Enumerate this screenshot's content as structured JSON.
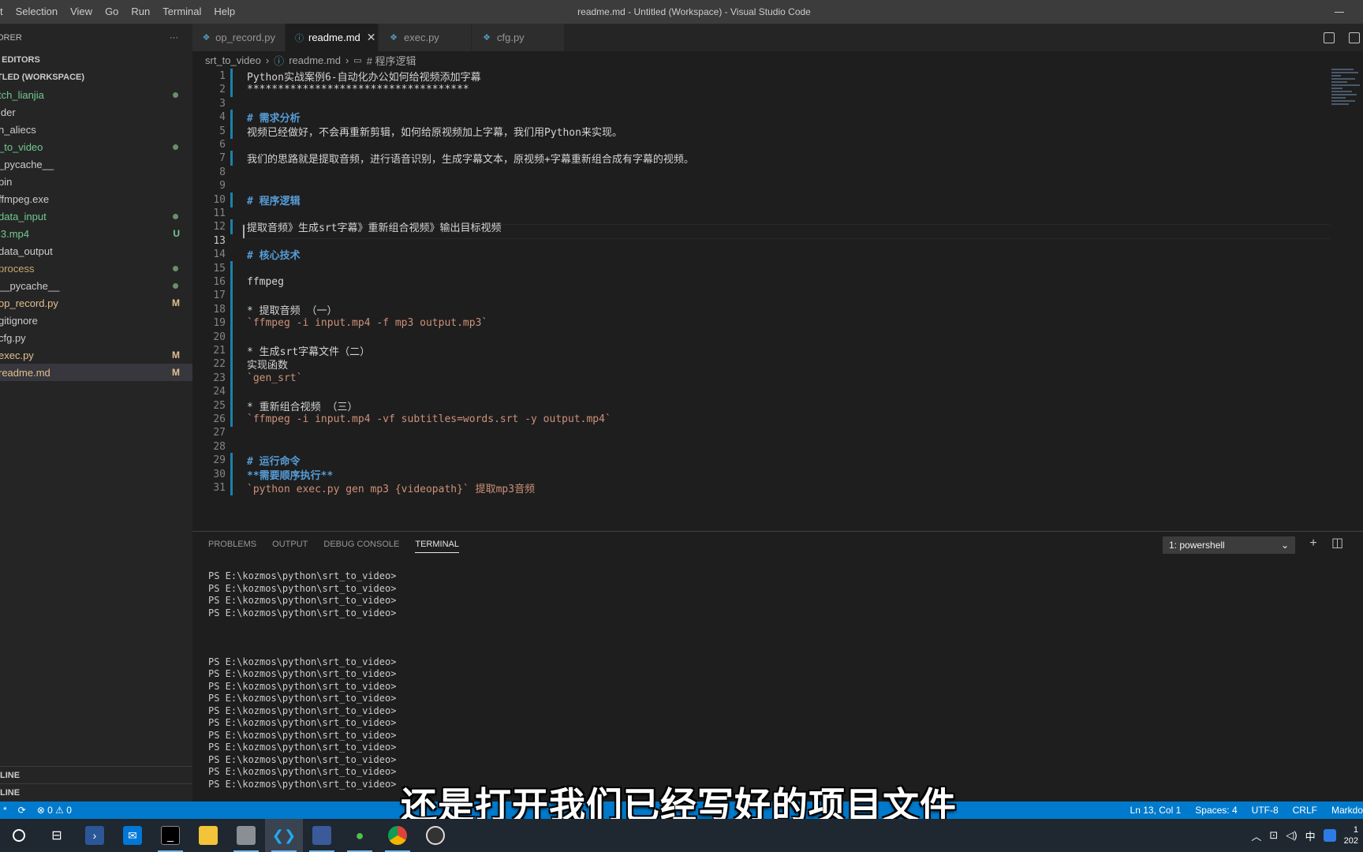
{
  "menu": [
    "t",
    "Selection",
    "View",
    "Go",
    "Run",
    "Terminal",
    "Help"
  ],
  "window_title": "readme.md - Untitled (Workspace) - Visual Studio Code",
  "sidebar": {
    "header": "ORER",
    "header_more": "···",
    "open_editors": "I EDITORS",
    "workspace": "TLED (WORKSPACE)",
    "items": [
      {
        "label": "tch_lianjia",
        "status": "dot",
        "color": "green"
      },
      {
        "label": "ider",
        "status": "",
        "color": ""
      },
      {
        "label": "n_aliecs",
        "status": "",
        "color": ""
      },
      {
        "label": "_to_video",
        "status": "dot",
        "color": "green"
      },
      {
        "label": "_pycache__",
        "status": "",
        "color": ""
      },
      {
        "label": "bin",
        "status": "",
        "color": ""
      },
      {
        "label": " ffmpeg.exe",
        "status": "",
        "color": ""
      },
      {
        "label": "data_input",
        "status": "dot",
        "color": "green"
      },
      {
        "label": " i3.mp4",
        "status": "U",
        "color": "green"
      },
      {
        "label": "data_output",
        "status": "",
        "color": ""
      },
      {
        "label": "process",
        "status": "dot",
        "color": "brown"
      },
      {
        "label": " __pycache__",
        "status": "dot",
        "color": ""
      },
      {
        "label": " op_record.py",
        "status": "M",
        "color": "yellow"
      },
      {
        "label": "gitignore",
        "status": "",
        "color": ""
      },
      {
        "label": "cfg.py",
        "status": "",
        "color": ""
      },
      {
        "label": "exec.py",
        "status": "M",
        "color": "yellow"
      },
      {
        "label": "readme.md",
        "status": "M",
        "color": "yellow",
        "active": true
      }
    ],
    "outline": "LINE",
    "timeline": "LINE"
  },
  "tabs": [
    {
      "label": "op_record.py",
      "icon": "python-icon",
      "active": false
    },
    {
      "label": "readme.md",
      "icon": "info-icon",
      "active": true,
      "close": "✕"
    },
    {
      "label": "exec.py",
      "icon": "python-icon",
      "active": false
    },
    {
      "label": "cfg.py",
      "icon": "python-icon",
      "active": false
    }
  ],
  "breadcrumb": {
    "folder": "srt_to_video",
    "file": "readme.md",
    "symbol": "# 程序逻辑"
  },
  "editor": {
    "lines": [
      {
        "n": "1",
        "text": "Python实战案例6-自动化办公如何给视频添加字幕",
        "style": "",
        "mod": true
      },
      {
        "n": "2",
        "text": "************************************",
        "style": "",
        "mod": true
      },
      {
        "n": "3",
        "text": "",
        "style": "",
        "mod": false
      },
      {
        "n": "4",
        "text": "# 需求分析",
        "style": "heading",
        "mod": true
      },
      {
        "n": "5",
        "text": "视频已经做好，不会再重新剪辑，如何给原视频加上字幕，我们用Python来实现。",
        "style": "",
        "mod": true
      },
      {
        "n": "6",
        "text": "",
        "style": "",
        "mod": false
      },
      {
        "n": "7",
        "text": "我们的思路就是提取音频，进行语音识别，生成字幕文本，原视频+字幕重新组合成有字幕的视频。",
        "style": "",
        "mod": true
      },
      {
        "n": "8",
        "text": "",
        "style": "",
        "mod": false
      },
      {
        "n": "9",
        "text": "",
        "style": "",
        "mod": false
      },
      {
        "n": "10",
        "text": "# 程序逻辑",
        "style": "heading",
        "mod": true
      },
      {
        "n": "11",
        "text": "",
        "style": "",
        "mod": false
      },
      {
        "n": "12",
        "text": "提取音频》生成srt字幕》重新组合视频》输出目标视频",
        "style": "",
        "mod": true
      },
      {
        "n": "13",
        "text": "",
        "style": "",
        "mod": false
      },
      {
        "n": "14",
        "text": "# 核心技术",
        "style": "heading",
        "mod": false
      },
      {
        "n": "15",
        "text": "",
        "style": "",
        "mod": true
      },
      {
        "n": "16",
        "text": "ffmpeg",
        "style": "",
        "mod": true
      },
      {
        "n": "17",
        "text": "",
        "style": "",
        "mod": true
      },
      {
        "n": "18",
        "text": "* 提取音频 （一）",
        "style": "",
        "mod": true
      },
      {
        "n": "19",
        "text": "`ffmpeg -i input.mp4 -f mp3 output.mp3`",
        "style": "inline",
        "mod": true
      },
      {
        "n": "20",
        "text": "",
        "style": "",
        "mod": true
      },
      {
        "n": "21",
        "text": "* 生成srt字幕文件（二）",
        "style": "",
        "mod": true
      },
      {
        "n": "22",
        "text": "实现函数",
        "style": "",
        "mod": true
      },
      {
        "n": "23",
        "text": "`gen_srt`",
        "style": "inline",
        "mod": true
      },
      {
        "n": "24",
        "text": "",
        "style": "",
        "mod": true
      },
      {
        "n": "25",
        "text": "* 重新组合视频 （三）",
        "style": "",
        "mod": true
      },
      {
        "n": "26",
        "text": "`ffmpeg -i input.mp4 -vf subtitles=words.srt -y output.mp4`",
        "style": "inline",
        "mod": true
      },
      {
        "n": "27",
        "text": "",
        "style": "",
        "mod": false
      },
      {
        "n": "28",
        "text": "",
        "style": "",
        "mod": false
      },
      {
        "n": "29",
        "text": "# 运行命令",
        "style": "heading",
        "mod": true
      },
      {
        "n": "30",
        "text": "**需要顺序执行**",
        "style": "bold",
        "mod": true
      },
      {
        "n": "31",
        "text": "`python exec.py gen mp3 {videopath}` 提取mp3音频",
        "style": "inline",
        "mod": true
      }
    ]
  },
  "panel": {
    "tabs": [
      "PROBLEMS",
      "OUTPUT",
      "DEBUG CONSOLE",
      "TERMINAL"
    ],
    "active_tab": "TERMINAL",
    "terminal_select": "1: powershell",
    "add": "+",
    "split": "◫",
    "terminal_lines": [
      "PS E:\\kozmos\\python\\srt_to_video>",
      "PS E:\\kozmos\\python\\srt_to_video>",
      "PS E:\\kozmos\\python\\srt_to_video>",
      "PS E:\\kozmos\\python\\srt_to_video>",
      "",
      "",
      "",
      "PS E:\\kozmos\\python\\srt_to_video>",
      "PS E:\\kozmos\\python\\srt_to_video>",
      "PS E:\\kozmos\\python\\srt_to_video>",
      "PS E:\\kozmos\\python\\srt_to_video>",
      "PS E:\\kozmos\\python\\srt_to_video>",
      "PS E:\\kozmos\\python\\srt_to_video>",
      "PS E:\\kozmos\\python\\srt_to_video>",
      "PS E:\\kozmos\\python\\srt_to_video>",
      "PS E:\\kozmos\\python\\srt_to_video>",
      "PS E:\\kozmos\\python\\srt_to_video>",
      "PS E:\\kozmos\\python\\srt_to_video>"
    ]
  },
  "statusbar": {
    "branch": "*",
    "sync": "⟳",
    "problems": "⊗ 0 ⚠ 0",
    "position": "Ln 13, Col 1",
    "spaces": "Spaces: 4",
    "encoding": "UTF-8",
    "eol": "CRLF",
    "language": "Markdo"
  },
  "subtitle": "还是打开我们已经写好的项目文件",
  "taskbar": {
    "tray_ime": "中",
    "tray_up": "︿",
    "clock_time": "1",
    "clock_date": "202"
  },
  "colors": {
    "accent": "#007acc",
    "heading": "#569cd6",
    "inline_code": "#ce9178",
    "git_modified": "#e2c08d",
    "git_untracked": "#73c991"
  }
}
